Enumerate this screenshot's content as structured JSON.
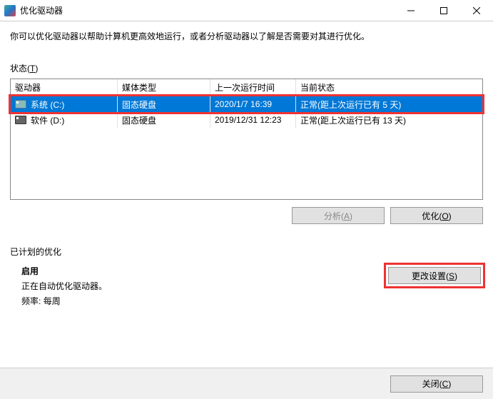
{
  "title": "优化驱动器",
  "description": "你可以优化驱动器以帮助计算机更高效地运行，或者分析驱动器以了解是否需要对其进行优化。",
  "statusLabel": "状态(T)",
  "columns": {
    "drive": "驱动器",
    "media": "媒体类型",
    "lastRun": "上一次运行时间",
    "current": "当前状态"
  },
  "rows": [
    {
      "drive": "系统 (C:)",
      "media": "固态硬盘",
      "lastRun": "2020/1/7 16:39",
      "current": "正常(距上次运行已有 5 天)",
      "selected": true
    },
    {
      "drive": "软件 (D:)",
      "media": "固态硬盘",
      "lastRun": "2019/12/31 12:23",
      "current": "正常(距上次运行已有 13 天)",
      "selected": false
    }
  ],
  "buttons": {
    "analyze": "分析(A)",
    "optimize": "优化(O)",
    "changeSettings": "更改设置(S)",
    "close": "关闭(C)"
  },
  "scheduleTitle": "已计划的优化",
  "schedule": {
    "enabled": "启用",
    "desc": "正在自动优化驱动器。",
    "freqLabel": "频率:",
    "freqValue": "每周"
  }
}
